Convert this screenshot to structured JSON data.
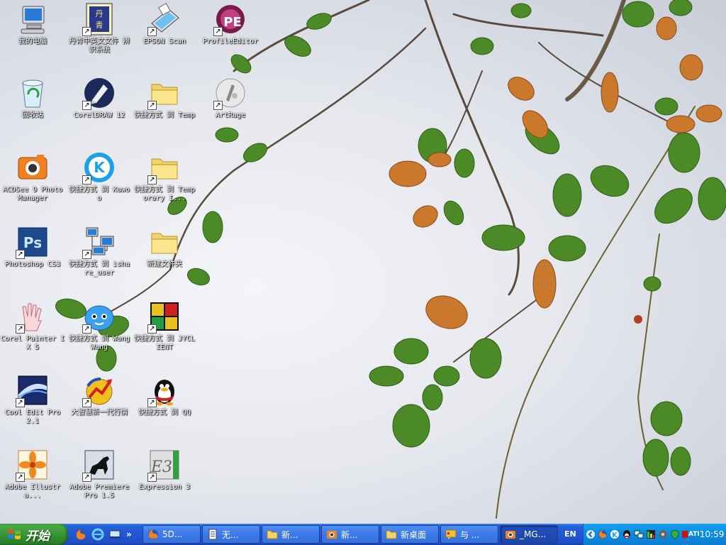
{
  "desktop": {
    "icons": [
      {
        "label": "我的电脑",
        "icon": "my-computer-icon",
        "shortcut": false
      },
      {
        "label": "丹青中英文文件 辨识系统",
        "icon": "danqing-ocr-icon",
        "shortcut": true
      },
      {
        "label": "EPSON Scan",
        "icon": "scanner-icon",
        "shortcut": true
      },
      {
        "label": "ProfileEditor",
        "icon": "profile-editor-icon",
        "shortcut": true
      },
      {
        "label": "回收站",
        "icon": "recycle-bin-icon",
        "shortcut": false
      },
      {
        "label": "CorelDRAW 12",
        "icon": "coreldraw-icon",
        "shortcut": true
      },
      {
        "label": "快捷方式 到 Temp",
        "icon": "folder-icon",
        "shortcut": true
      },
      {
        "label": "ArtRage",
        "icon": "artrage-icon",
        "shortcut": true
      },
      {
        "label": "ACDSee 9 Photo Manager",
        "icon": "acdsee-icon",
        "shortcut": false
      },
      {
        "label": "快捷方式 到 Kuwoo",
        "icon": "kuwo-icon",
        "shortcut": true
      },
      {
        "label": "快捷方式 到 Temporary I...",
        "icon": "folder-icon",
        "shortcut": true
      },
      {
        "label": "Photoshop CS3",
        "icon": "photoshop-icon",
        "shortcut": true
      },
      {
        "label": "快捷方式 到 ishare_user",
        "icon": "network-computer-icon",
        "shortcut": true
      },
      {
        "label": "新建文件夹",
        "icon": "folder-icon",
        "shortcut": false
      },
      {
        "label": "Corel Painter IX 5",
        "icon": "painter-hand-icon",
        "shortcut": true
      },
      {
        "label": "快捷方式 到 WangWang",
        "icon": "wangwang-icon",
        "shortcut": true
      },
      {
        "label": "快捷方式 到 JYCLIENT",
        "icon": "jyclient-icon",
        "shortcut": true
      },
      {
        "label": "Cool Edit Pro 2.1",
        "icon": "cool-edit-icon",
        "shortcut": true
      },
      {
        "label": "大智慧新一代行情",
        "icon": "dazhihui-icon",
        "shortcut": true
      },
      {
        "label": "快捷方式 到 QQ",
        "icon": "qq-penguin-icon",
        "shortcut": true
      },
      {
        "label": "Adobe Illustra...",
        "icon": "illustrator-flower-icon",
        "shortcut": true
      },
      {
        "label": "Adobe Premiere Pro 1.5",
        "icon": "premiere-horse-icon",
        "shortcut": true
      },
      {
        "label": "Expression 3",
        "icon": "expression-icon",
        "shortcut": true
      }
    ]
  },
  "taskbar": {
    "start_label": "开始",
    "quicklaunch": [
      "firefox-icon",
      "ie-icon",
      "show-desktop-icon"
    ],
    "chevron": "»",
    "tasks": [
      {
        "label": "5D...",
        "icon": "firefox-icon",
        "active": false
      },
      {
        "label": "无...",
        "icon": "document-icon",
        "active": false
      },
      {
        "label": "新...",
        "icon": "folder-icon",
        "active": false
      },
      {
        "label": "新...",
        "icon": "acdsee-icon",
        "active": false
      },
      {
        "label": "新桌面",
        "icon": "folder-icon",
        "active": false
      },
      {
        "label": "与 ...",
        "icon": "chat-icon",
        "active": false
      },
      {
        "label": "_MG...",
        "icon": "acdsee-icon",
        "active": true
      }
    ],
    "language": "EN",
    "tray_icons": [
      "tray-collapse-icon",
      "firefox-tray-icon",
      "kuwo-tray-icon",
      "qq-tray-icon",
      "network-tray-icon",
      "volume-meter-icon",
      "disk-tray-icon",
      "shield-tray-icon",
      "ati-tray-icon"
    ],
    "ati_text": "ATI",
    "clock": "10:59"
  }
}
